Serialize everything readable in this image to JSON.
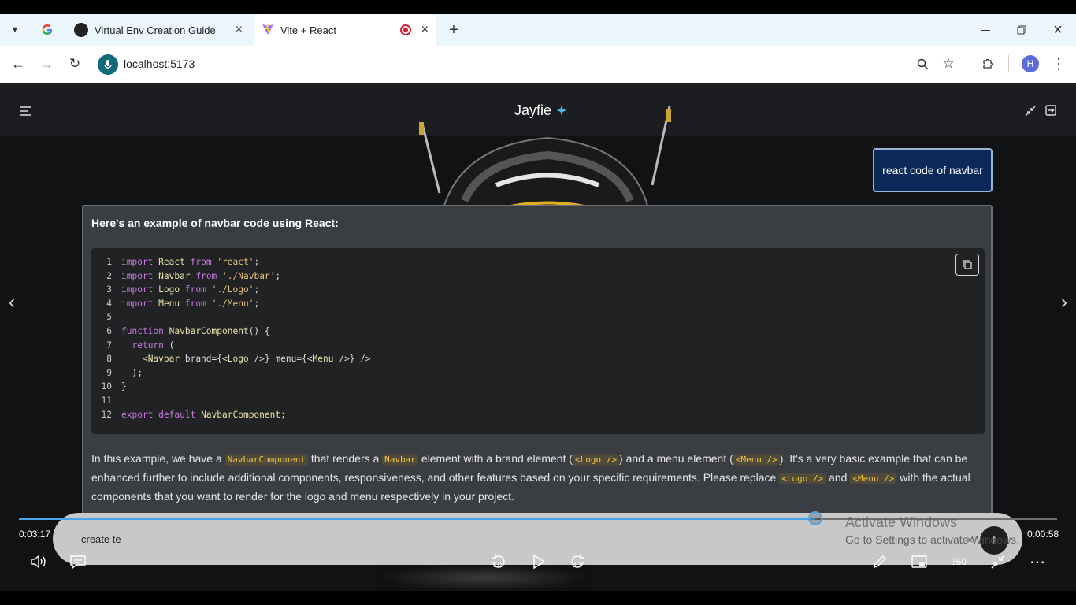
{
  "browser": {
    "tabs": [
      {
        "title": "Virtual Env Creation Guide",
        "favicon": "chatgpt-icon"
      },
      {
        "title": "Vite + React",
        "favicon": "vite-icon"
      }
    ],
    "address": "localhost:5173",
    "profile_initial": "H"
  },
  "app": {
    "title": "Jayfie",
    "user_prompt": "react code of navbar",
    "answer_intro": "Here's an example of navbar code using React:",
    "code_lines": [
      {
        "n": "1",
        "text": "import React from 'react';"
      },
      {
        "n": "2",
        "text": "import Navbar from './Navbar';"
      },
      {
        "n": "3",
        "text": "import Logo from './Logo';"
      },
      {
        "n": "4",
        "text": "import Menu from './Menu';"
      },
      {
        "n": "5",
        "text": ""
      },
      {
        "n": "6",
        "text": "function NavbarComponent() {"
      },
      {
        "n": "7",
        "text": "  return ("
      },
      {
        "n": "8",
        "text": "    <Navbar brand={<Logo />} menu={<Menu />} />"
      },
      {
        "n": "9",
        "text": "  );"
      },
      {
        "n": "10",
        "text": "}"
      },
      {
        "n": "11",
        "text": ""
      },
      {
        "n": "12",
        "text": "export default NavbarComponent;"
      }
    ],
    "explanation": {
      "p1": "In this example, we have a",
      "c1": "NavbarComponent",
      "p2": "that renders a",
      "c2": "Navbar",
      "p3": "element with a brand element (",
      "c3": "<Logo />",
      "p4": ") and a menu element (",
      "c4": "<Menu />",
      "p5": "). It's a very basic example that can be enhanced further to include additional components, responsiveness, and other features based on your specific requirements. Please replace",
      "c5": "<Logo />",
      "p6": "and",
      "c6": "<Menu />",
      "p7": "with the actual components that you want to render for the logo and menu respectively in your project."
    },
    "input_value": "create te"
  },
  "player": {
    "elapsed": "0:03:17",
    "remaining": "0:00:58",
    "progress_fraction": 0.767,
    "rewind_label": "10",
    "forward_label": "30",
    "vr_label": "360"
  },
  "watermark": {
    "line1": "Activate Windows",
    "line2": "Go to Settings to activate Windows."
  },
  "colors": {
    "accent": "#4aa3e6",
    "prompt_bubble": "#0b2a5a",
    "code_keyword": "#c678dd",
    "code_string": "#e5c07b",
    "inline_code": "#f5c23d"
  }
}
